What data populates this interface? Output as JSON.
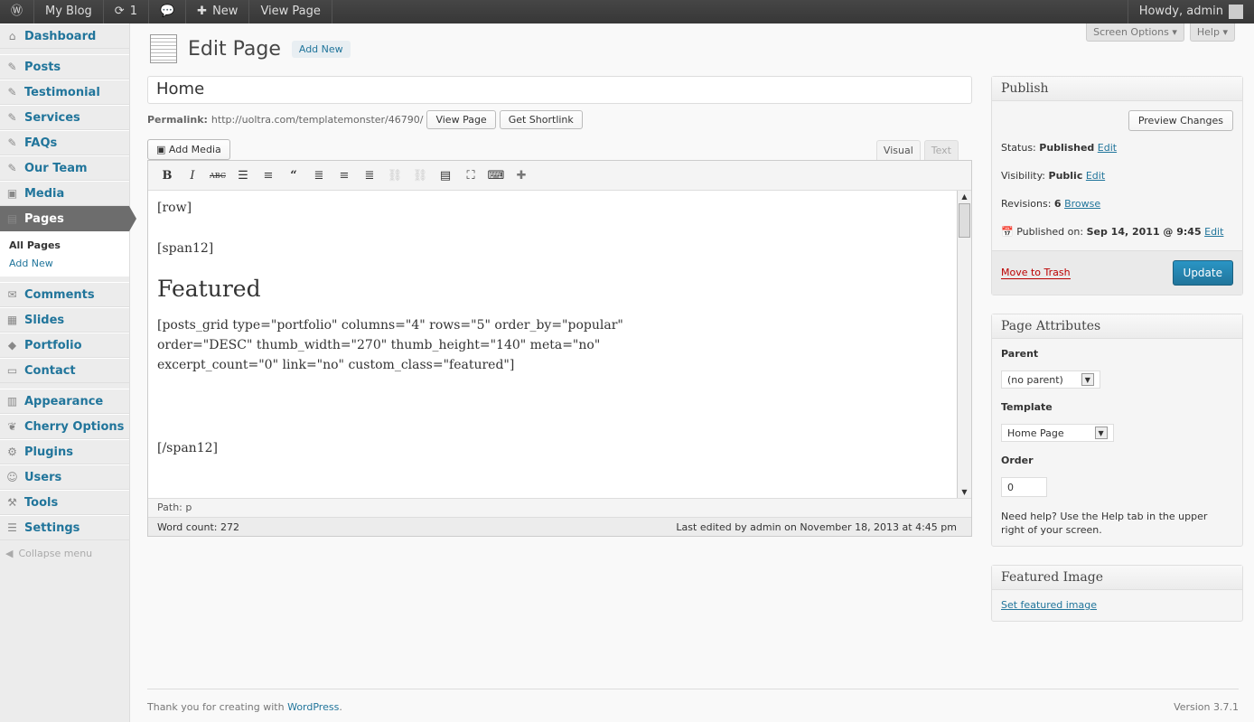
{
  "adminbar": {
    "site": "My Blog",
    "updates": "1",
    "new": "New",
    "view": "View Page",
    "howdy": "Howdy, admin"
  },
  "sidebar": {
    "items": [
      {
        "label": "Dashboard",
        "icon": "⌂"
      },
      {
        "label": "Posts",
        "icon": "✎"
      },
      {
        "label": "Testimonial",
        "icon": "✎"
      },
      {
        "label": "Services",
        "icon": "✎"
      },
      {
        "label": "FAQs",
        "icon": "✎"
      },
      {
        "label": "Our Team",
        "icon": "✎"
      },
      {
        "label": "Media",
        "icon": "▣"
      },
      {
        "label": "Pages",
        "icon": "▤"
      },
      {
        "label": "Comments",
        "icon": "✉"
      },
      {
        "label": "Slides",
        "icon": "▦"
      },
      {
        "label": "Portfolio",
        "icon": "◆"
      },
      {
        "label": "Contact",
        "icon": "▭"
      },
      {
        "label": "Appearance",
        "icon": "▥"
      },
      {
        "label": "Cherry Options",
        "icon": "❦"
      },
      {
        "label": "Plugins",
        "icon": "⚙"
      },
      {
        "label": "Users",
        "icon": "☺"
      },
      {
        "label": "Tools",
        "icon": "⚒"
      },
      {
        "label": "Settings",
        "icon": "☰"
      }
    ],
    "sub": [
      "All Pages",
      "Add New"
    ],
    "collapse": "Collapse menu"
  },
  "header": {
    "title": "Edit Page",
    "add_new": "Add New",
    "screen_options": "Screen Options ▾",
    "help": "Help ▾"
  },
  "post": {
    "title": "Home",
    "permalink_label": "Permalink:",
    "permalink": "http://uoltra.com/templatemonster/46790/",
    "view_page": "View Page",
    "get_shortlink": "Get Shortlink",
    "add_media": "Add Media",
    "tab_visual": "Visual",
    "tab_text": "Text"
  },
  "editor": {
    "p1": "[row]",
    "p2": "[span12]",
    "h1": "Featured",
    "p3": "[posts_grid type=\"portfolio\" columns=\"4\" rows=\"5\" order_by=\"popular\" order=\"DESC\" thumb_width=\"270\" thumb_height=\"140\" meta=\"no\" excerpt_count=\"0\" link=\"no\" custom_class=\"featured\"]",
    "p4": "[/span12]",
    "path": "Path: p",
    "word_count": "Word count: 272",
    "last_edited": "Last edited by admin on November 18, 2013 at 4:45 pm"
  },
  "publish": {
    "title": "Publish",
    "preview": "Preview Changes",
    "status_label": "Status:",
    "status": "Published",
    "edit": "Edit",
    "visibility_label": "Visibility:",
    "visibility": "Public",
    "revisions_label": "Revisions:",
    "revisions": "6",
    "browse": "Browse",
    "published_label": "Published on:",
    "published": "Sep 14, 2011 @ 9:45",
    "trash": "Move to Trash",
    "update": "Update"
  },
  "attributes": {
    "title": "Page Attributes",
    "parent_label": "Parent",
    "parent": "(no parent)",
    "template_label": "Template",
    "template": "Home Page",
    "order_label": "Order",
    "order": "0",
    "help": "Need help? Use the Help tab in the upper right of your screen."
  },
  "featured": {
    "title": "Featured Image",
    "set": "Set featured image"
  },
  "footer": {
    "thanks": "Thank you for creating with ",
    "wp": "WordPress",
    "dot": ".",
    "version": "Version 3.7.1"
  }
}
